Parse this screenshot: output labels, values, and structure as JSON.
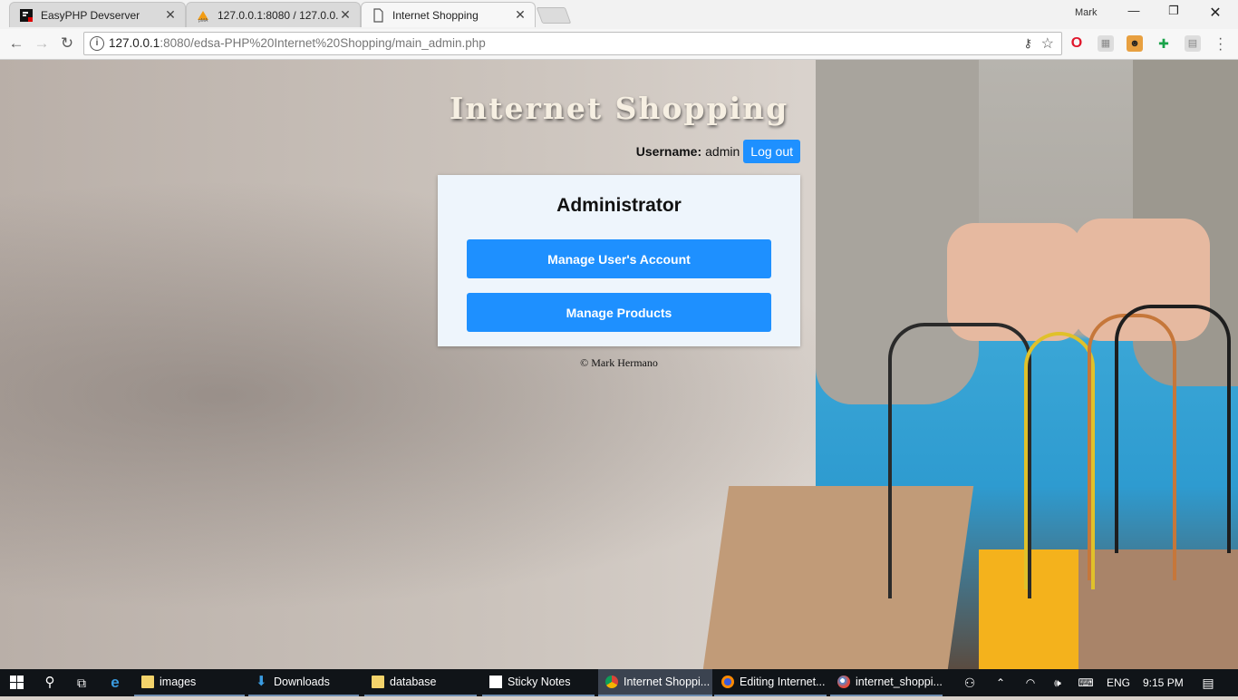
{
  "browser": {
    "tabs": [
      {
        "title": "EasyPHP Devserver",
        "icon": "easyphp-icon",
        "active": false
      },
      {
        "title": "127.0.0.1:8080 / 127.0.0.1",
        "icon": "phpmyadmin-icon",
        "active": false
      },
      {
        "title": "Internet Shopping",
        "icon": "page-icon",
        "active": true
      }
    ],
    "profile_name": "Mark",
    "url_host": "127.0.0.1",
    "url_rest": ":8080/edsa-PHP%20Internet%20Shopping/main_admin.php"
  },
  "page": {
    "site_title": "Internet Shopping",
    "username_label": "Username:",
    "username_value": "admin",
    "logout_label": "Log out",
    "panel_title": "Administrator",
    "manage_users_label": "Manage User's Account",
    "manage_products_label": "Manage Products",
    "footer": "© Mark Hermano",
    "accent_color": "#1e90ff"
  },
  "taskbar": {
    "items": [
      {
        "label": "images",
        "icon": "folder-icon"
      },
      {
        "label": "Downloads",
        "icon": "download-icon"
      },
      {
        "label": "database",
        "icon": "folder-icon"
      },
      {
        "label": "Sticky Notes",
        "icon": "sticky-notes-icon"
      },
      {
        "label": "Internet Shoppi...",
        "icon": "chrome-icon"
      },
      {
        "label": "Editing Internet...",
        "icon": "firefox-icon"
      },
      {
        "label": "internet_shoppi...",
        "icon": "paint-icon"
      }
    ],
    "language": "ENG",
    "time": "9:15 PM"
  }
}
